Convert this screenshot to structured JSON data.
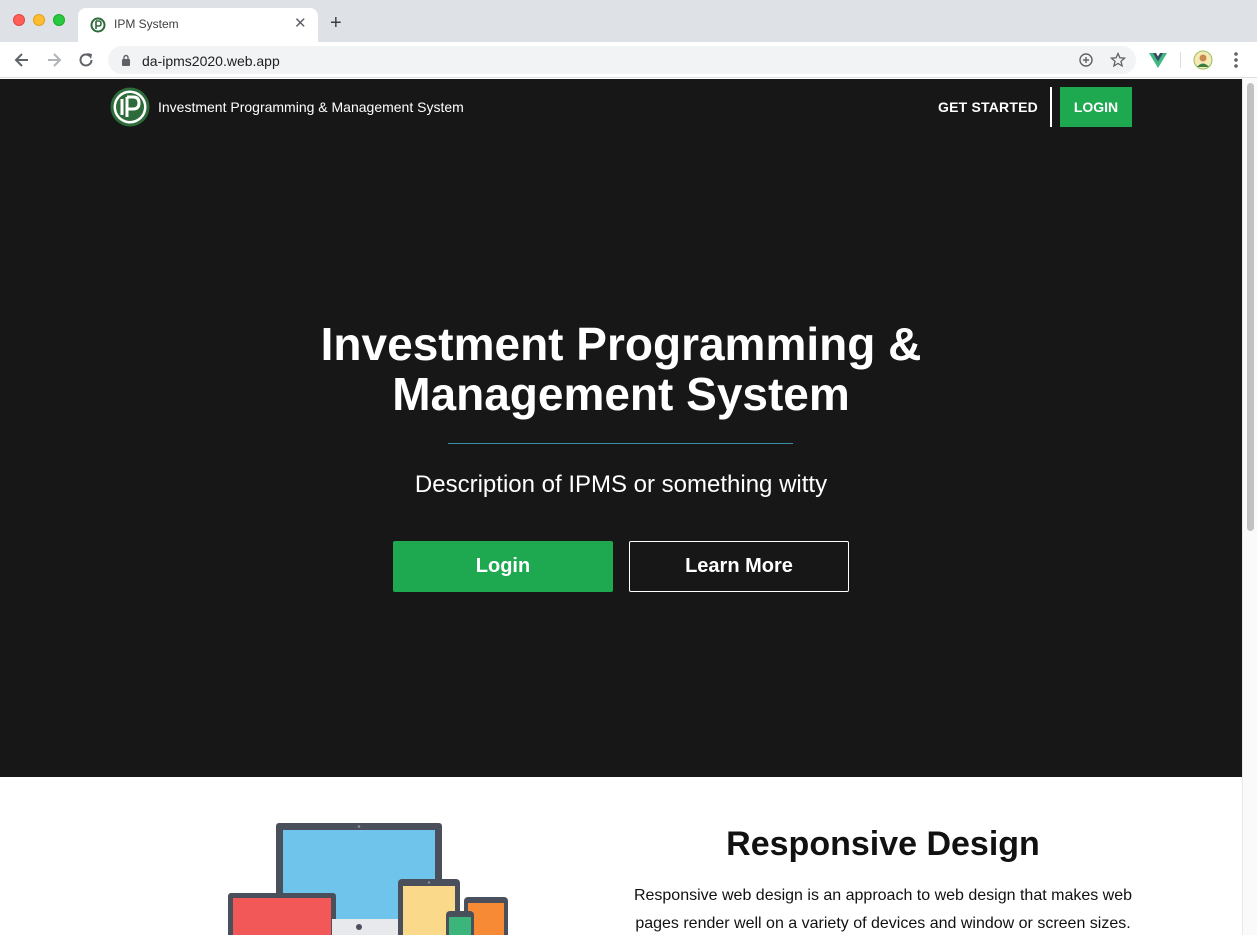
{
  "browser": {
    "tab_title": "IPM System",
    "tab_close": "✕",
    "new_tab": "+",
    "url": "da-ipms2020.web.app"
  },
  "site": {
    "brand_name": "Investment Programming & Management System",
    "nav": {
      "get_started": "GET STARTED",
      "login": "LOGIN"
    },
    "hero": {
      "title": "Investment Programming & Management System",
      "subtitle": "Description of IPMS or something witty",
      "login_button": "Login",
      "learn_more_button": "Learn More"
    },
    "feature": {
      "title": "Responsive Design",
      "text": "Responsive web design is an approach to web design that makes web pages render well on a variety of devices and window or screen sizes."
    }
  },
  "colors": {
    "hero_bg": "#171717",
    "accent_green": "#1ea951",
    "rule_teal": "#3b8fa8"
  },
  "icons": [
    "back-icon",
    "forward-icon",
    "reload-icon",
    "lock-icon",
    "add-page-icon",
    "star-icon",
    "vue-devtools-icon",
    "profile-icon",
    "menu-icon"
  ]
}
